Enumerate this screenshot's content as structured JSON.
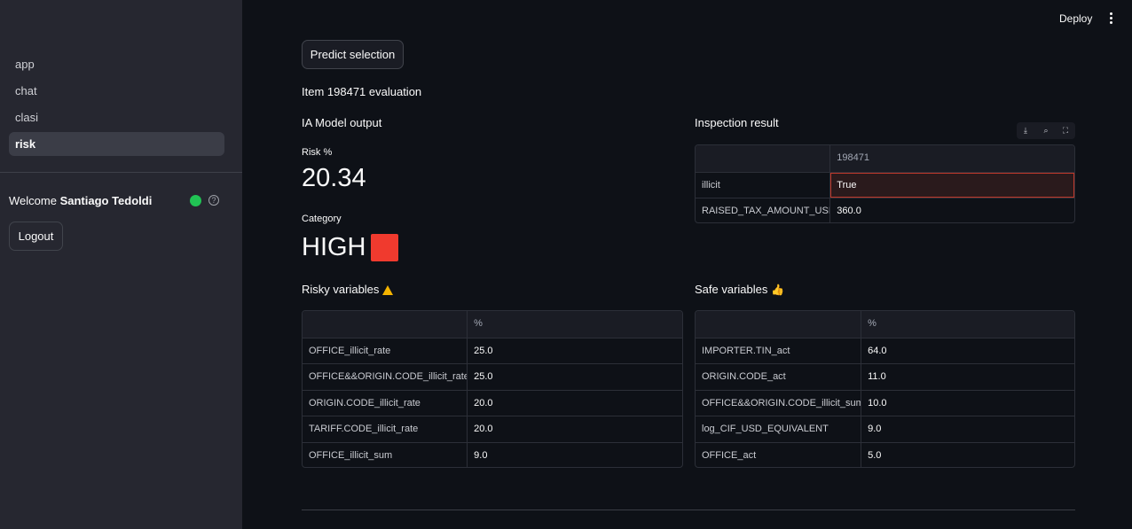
{
  "sidebar": {
    "items": [
      {
        "label": "app"
      },
      {
        "label": "chat"
      },
      {
        "label": "clasi"
      },
      {
        "label": "risk"
      }
    ],
    "welcome_prefix": "Welcome ",
    "user_name": "Santiago Tedoldi",
    "help_glyph": "?",
    "logout_label": "Logout"
  },
  "header": {
    "deploy_label": "Deploy"
  },
  "main": {
    "predict_label": "Predict selection",
    "item_title": "Item 198471 evaluation",
    "model_output_title": "IA Model output",
    "risk_label": "Risk %",
    "risk_value": "20.34",
    "category_label": "Category",
    "category_value": "HIGH",
    "category_color": "#f03a2e",
    "inspection_title": "Inspection result",
    "inspection_table": {
      "header": [
        "",
        "198471"
      ],
      "rows": [
        [
          "illicit",
          "True"
        ],
        [
          "RAISED_TAX_AMOUNT_USD",
          "360.0"
        ]
      ]
    },
    "risky_title": "Risky variables",
    "risky_table": {
      "header": [
        "",
        "%"
      ],
      "rows": [
        [
          "OFFICE_illicit_rate",
          "25.0"
        ],
        [
          "OFFICE&&ORIGIN.CODE_illicit_rate",
          "25.0"
        ],
        [
          "ORIGIN.CODE_illicit_rate",
          "20.0"
        ],
        [
          "TARIFF.CODE_illicit_rate",
          "20.0"
        ],
        [
          "OFFICE_illicit_sum",
          "9.0"
        ]
      ]
    },
    "safe_title": "Safe variables",
    "safe_table": {
      "header": [
        "",
        "%"
      ],
      "rows": [
        [
          "IMPORTER.TIN_act",
          "64.0"
        ],
        [
          "ORIGIN.CODE_act",
          "11.0"
        ],
        [
          "OFFICE&&ORIGIN.CODE_illicit_sum",
          "10.0"
        ],
        [
          "log_CIF_USD_EQUIVALENT",
          "9.0"
        ],
        [
          "OFFICE_act",
          "5.0"
        ]
      ]
    }
  },
  "colors": {
    "status_online": "#21c354",
    "warning": "#f5b400"
  }
}
